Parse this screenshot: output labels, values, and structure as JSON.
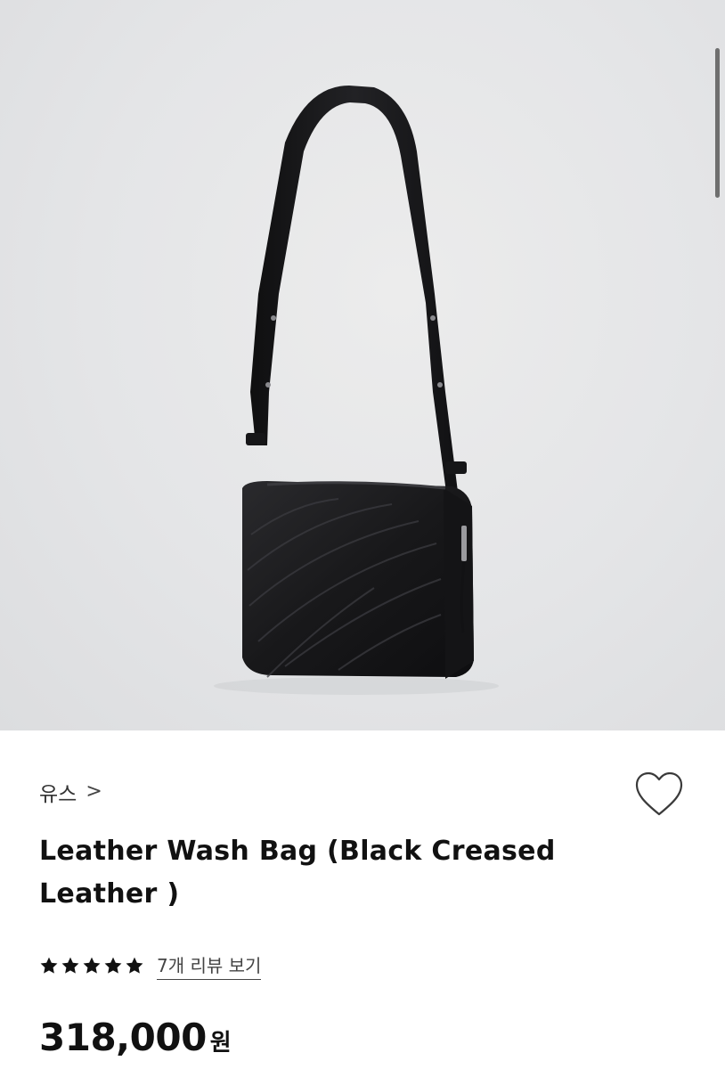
{
  "product_image": {
    "alt": "Leather Wash Bag black creased leather shoulder bag",
    "background_color": "#e5e6e8",
    "bag_color": "#1a1a1c"
  },
  "brand": {
    "name": "유스",
    "chevron": ">"
  },
  "wishlist": {
    "icon": "heart-outline-icon"
  },
  "product": {
    "title": "Leather Wash Bag (Black Creased Leather )"
  },
  "rating": {
    "stars": 5,
    "max": 5,
    "review_link": "7개 리뷰 보기"
  },
  "price": {
    "amount": "318,000",
    "currency": "원"
  }
}
